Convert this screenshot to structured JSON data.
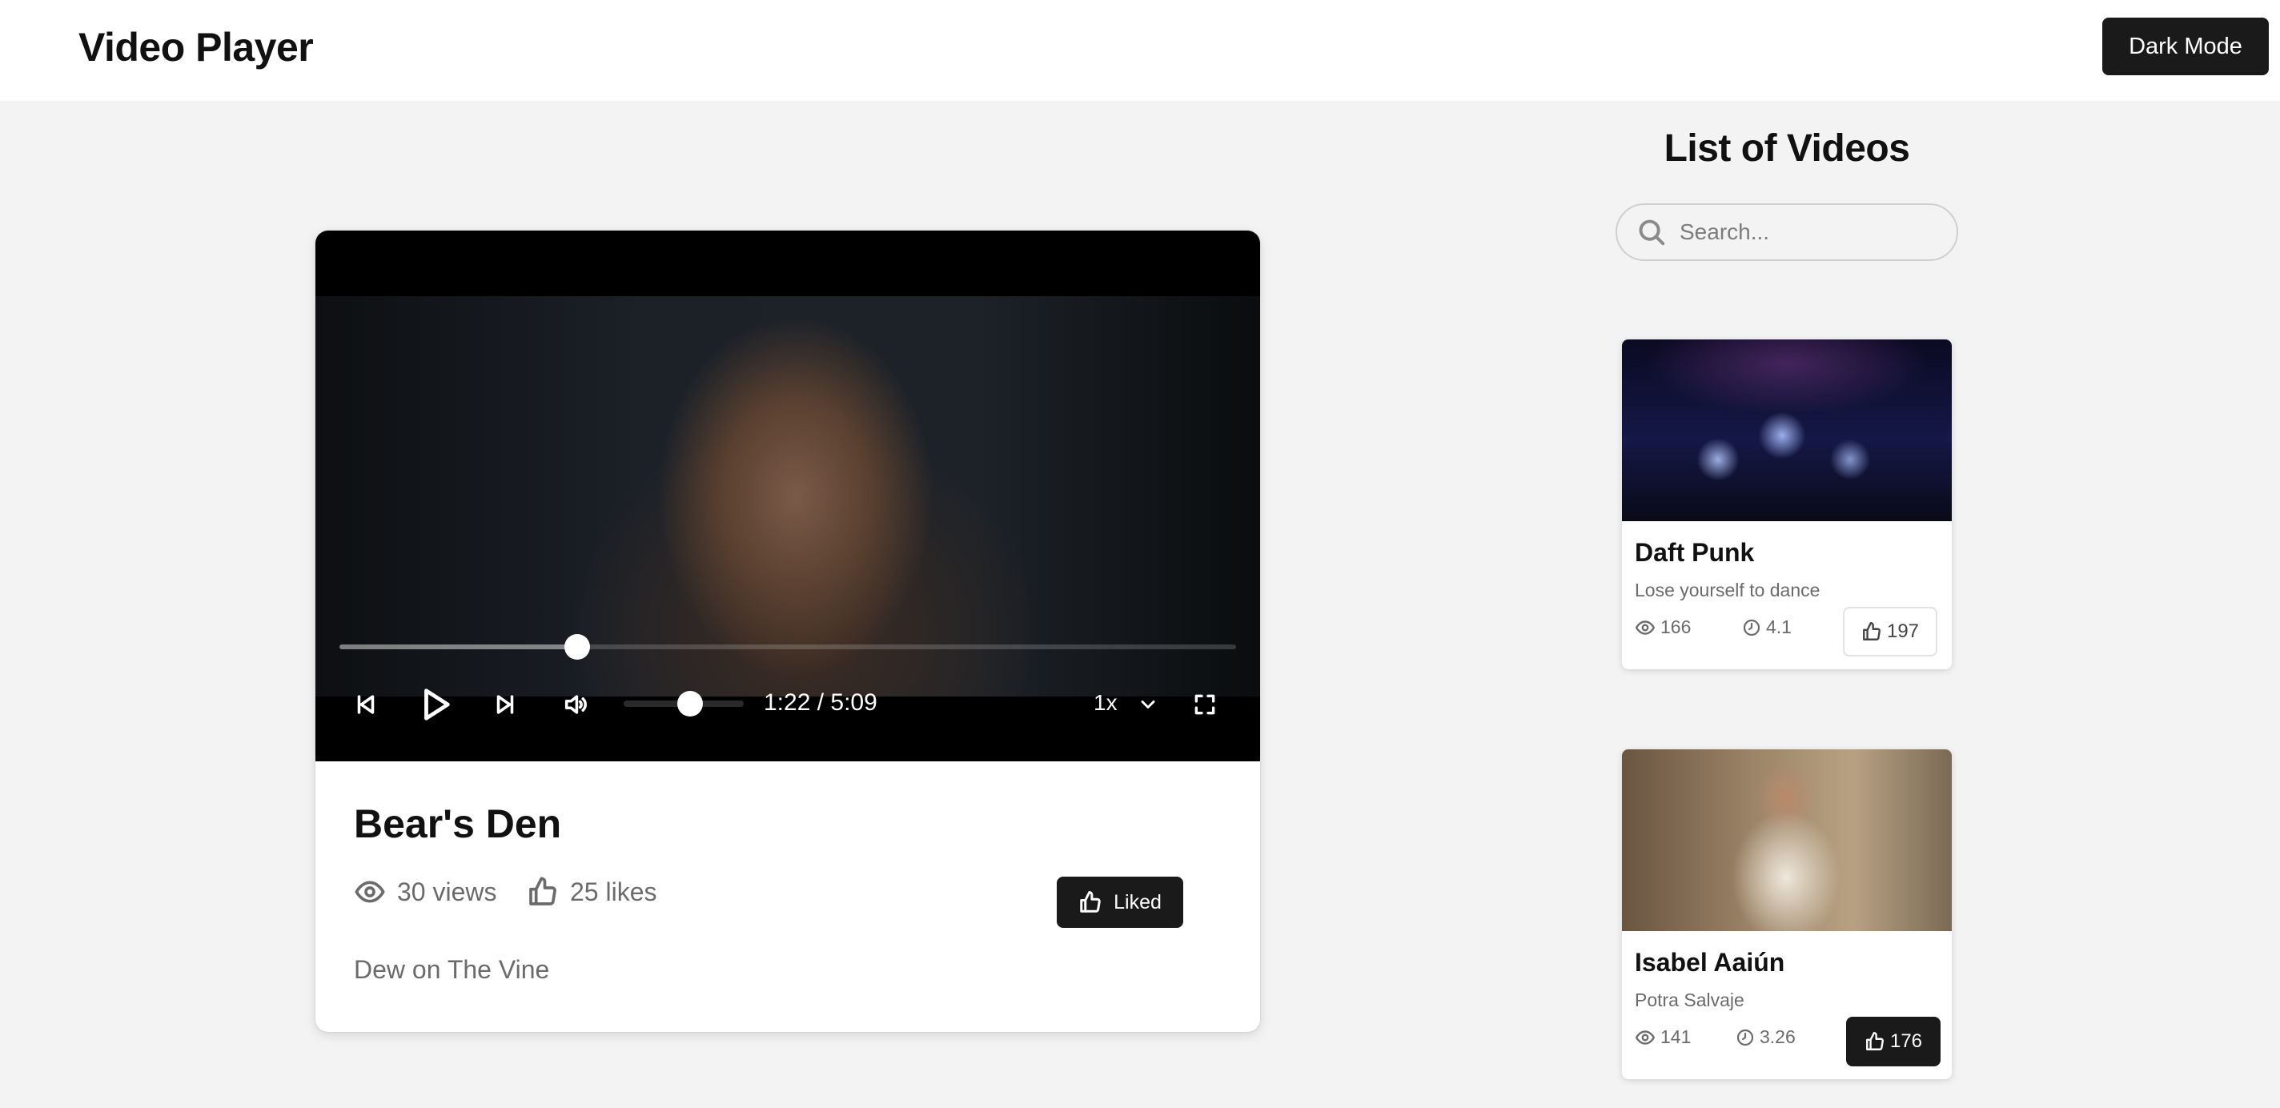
{
  "header": {
    "title": "Video Player",
    "dark_mode_label": "Dark Mode"
  },
  "player": {
    "title": "Bear's Den",
    "views": "30 views",
    "likes": "25 likes",
    "liked_label": "Liked",
    "description": "Dew on The Vine",
    "time": "1:22 / 5:09",
    "speed": "1x",
    "progress_fraction": 0.265,
    "volume_fraction": 0.55
  },
  "sidebar": {
    "title": "List of Videos",
    "search_placeholder": "Search...",
    "videos": [
      {
        "title": "Daft Punk",
        "subtitle": "Lose yourself to dance",
        "views": "166",
        "duration": "4.1",
        "likes": "197",
        "liked": false
      },
      {
        "title": "Isabel Aaiún",
        "subtitle": "Potra Salvaje",
        "views": "141",
        "duration": "3.26",
        "likes": "176",
        "liked": true
      }
    ]
  },
  "colors": {
    "accent": "#1a1a1a",
    "background": "#f3f3f3",
    "muted_text": "#6b6b6b"
  },
  "icons": [
    "search-icon",
    "eye-icon",
    "thumbs-up-icon",
    "clock-icon",
    "skip-back-icon",
    "play-icon",
    "skip-forward-icon",
    "volume-icon",
    "chevron-down-icon",
    "fullscreen-icon"
  ]
}
